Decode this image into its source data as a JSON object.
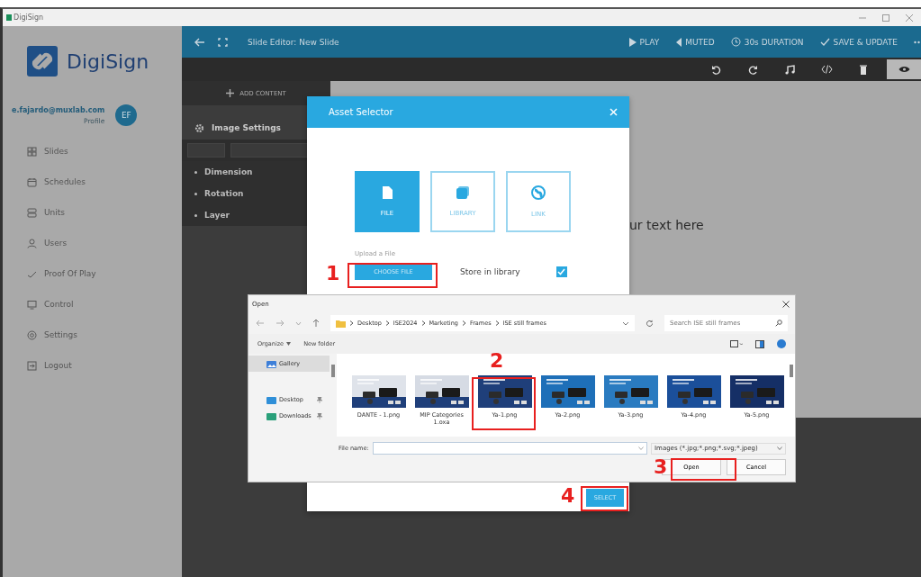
{
  "window": {
    "title": "DigiSign"
  },
  "sidebar": {
    "brand": "DigiSign",
    "email": "e.fajardo@muxlab.com",
    "profile_link": "Profile",
    "initials": "EF",
    "items": [
      {
        "label": "Slides"
      },
      {
        "label": "Schedules"
      },
      {
        "label": "Units"
      },
      {
        "label": "Users"
      },
      {
        "label": "Proof Of Play"
      },
      {
        "label": "Control"
      },
      {
        "label": "Settings"
      },
      {
        "label": "Logout"
      }
    ]
  },
  "header": {
    "title": "Slide Editor: New Slide",
    "actions": [
      {
        "label": "PLAY",
        "kind": "play"
      },
      {
        "label": "MUTED",
        "kind": "muted"
      },
      {
        "label": "30s DURATION",
        "kind": "duration"
      },
      {
        "label": "SAVE & UPDATE",
        "kind": "save"
      }
    ]
  },
  "toolbar": {
    "tools": [
      {
        "kind": "undo",
        "selected": false
      },
      {
        "kind": "redo",
        "selected": false
      },
      {
        "kind": "music",
        "selected": false
      },
      {
        "kind": "code",
        "selected": false
      },
      {
        "kind": "delete",
        "selected": false
      },
      {
        "kind": "preview",
        "selected": true
      }
    ]
  },
  "editor_panel": {
    "add_button": "ADD CONTENT",
    "section_title": "Image Settings",
    "items": [
      "Dimension",
      "Rotation",
      "Layer"
    ]
  },
  "canvas": {
    "text": "ur text here"
  },
  "asset_selector": {
    "title": "Asset Selector",
    "sources": [
      {
        "label": "FILE",
        "kind": "file",
        "selected": true
      },
      {
        "label": "LIBRARY",
        "kind": "library",
        "selected": false
      },
      {
        "label": "LINK",
        "kind": "link",
        "selected": false
      }
    ],
    "upload_label": "Upload a File",
    "choose_button": "CHOOSE FILE",
    "store_label": "Store in library",
    "store_checked": true,
    "select_button": "SELECT"
  },
  "open_dialog": {
    "title": "Open",
    "path": [
      "Desktop",
      "ISE2024",
      "Marketing",
      "Frames",
      "ISE still frames"
    ],
    "search_placeholder": "Search ISE still frames",
    "organize": "Organize",
    "new_folder": "New folder",
    "nav": [
      {
        "label": "Gallery",
        "selected": true
      },
      {
        "label": "Desktop",
        "selected": false
      },
      {
        "label": "Downloads",
        "selected": false
      }
    ],
    "files": [
      {
        "name": "DANTE - 1.png"
      },
      {
        "name": "MIP Categories 1.oxa"
      },
      {
        "name": "Ya-1.png"
      },
      {
        "name": "Ya-2.png"
      },
      {
        "name": "Ya-3.png"
      },
      {
        "name": "Ya-4.png"
      },
      {
        "name": "Ya-5.png"
      }
    ],
    "file_name_label": "File name:",
    "filter": "Images (*.jpg;*.png;*.svg;*.jpeg)",
    "open_button": "Open",
    "cancel_button": "Cancel"
  },
  "annotations": [
    {
      "label": "1"
    },
    {
      "label": "2"
    },
    {
      "label": "3"
    },
    {
      "label": "4"
    }
  ]
}
